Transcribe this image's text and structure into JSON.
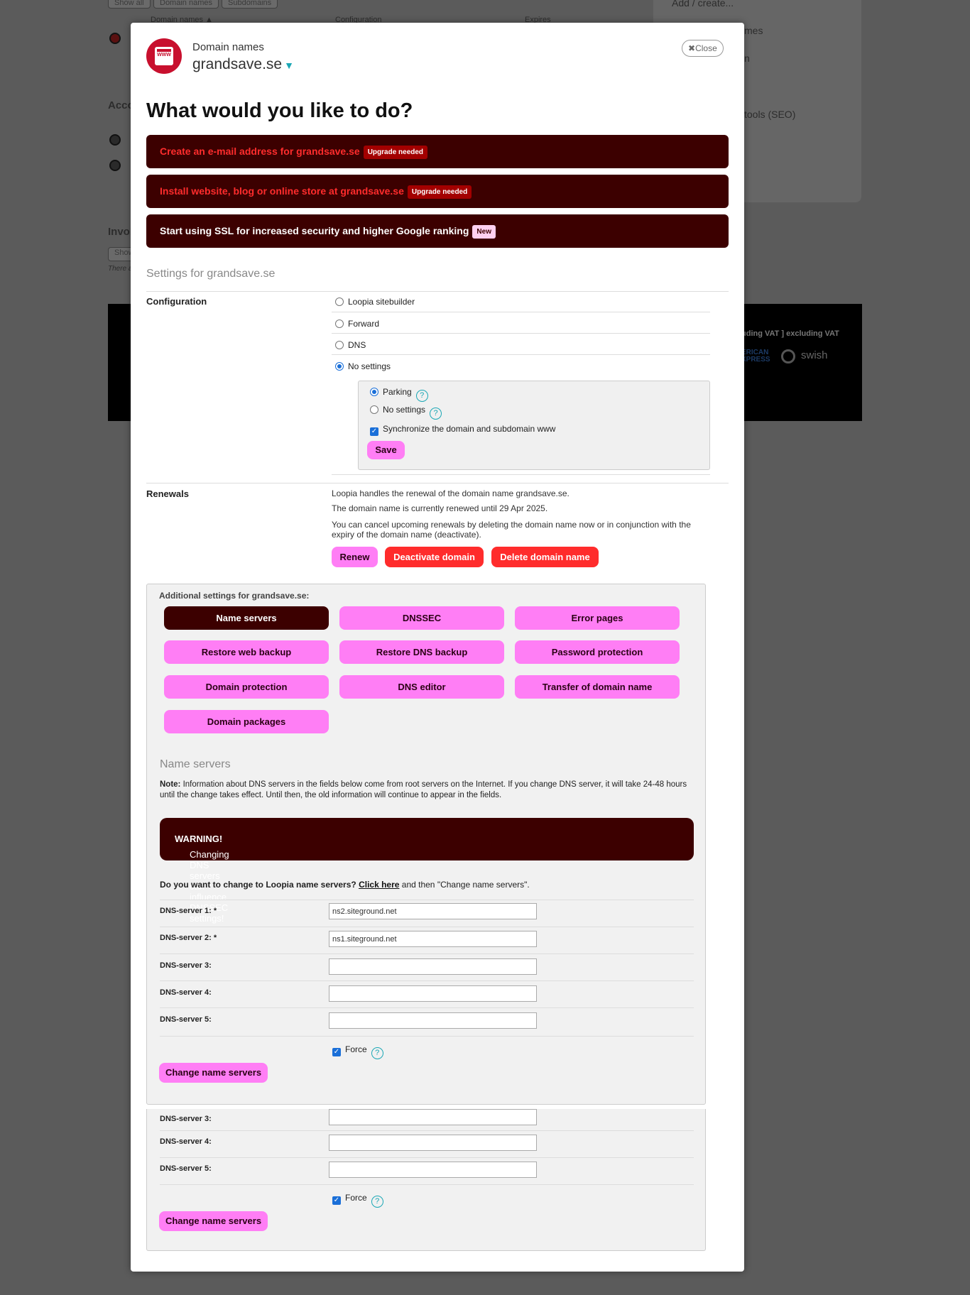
{
  "background": {
    "buttons": [
      "Show all",
      "Domain names",
      "Subdomains"
    ],
    "table_headers": [
      "Domain names ▲",
      "Configuration",
      "Expires"
    ],
    "section_acco": "Acco",
    "section_invo": "Invol",
    "show_btn": "Show",
    "there_text": "There a",
    "right_items": [
      "Add / create...",
      "mes",
      "n",
      "tools (SEO)"
    ],
    "vat_text": "uding VAT ] excluding VAT",
    "payment_text": "ERICAN XPRESS",
    "swish": "swish"
  },
  "modal": {
    "subtitle": "Domain names",
    "domain": "grandsave.se",
    "close_label": "Close",
    "title": "What would you like to do?",
    "actions": [
      {
        "label": "Create an e-mail address for grandsave.se",
        "badge": "Upgrade needed"
      },
      {
        "label": "Install website, blog or online store at grandsave.se",
        "badge": "Upgrade needed"
      },
      {
        "label": "Start using SSL for increased security and higher Google ranking",
        "badge": "New"
      }
    ],
    "settings_title": "Settings for grandsave.se",
    "configuration": {
      "label": "Configuration",
      "options": [
        "Loopia sitebuilder",
        "Forward",
        "DNS",
        "No settings"
      ],
      "selected": "No settings",
      "sub_options": [
        "Parking",
        "No settings"
      ],
      "sub_selected": "Parking",
      "sync_label": "Synchronize the domain and subdomain www",
      "sync_checked": true,
      "save_label": "Save"
    },
    "renewals": {
      "label": "Renewals",
      "line1": "Loopia handles the renewal of the domain name grandsave.se.",
      "line2": "The domain name is currently renewed until 29 Apr 2025.",
      "line3": "You can cancel upcoming renewals by deleting the domain name now or in conjunction with the",
      "line4": "expiry of the domain name (deactivate).",
      "renew": "Renew",
      "deactivate": "Deactivate domain",
      "delete": "Delete domain name"
    },
    "additional": {
      "title": "Additional settings for grandsave.se:",
      "buttons": [
        "Name servers",
        "DNSSEC",
        "Error pages",
        "Restore web backup",
        "Restore DNS backup",
        "Password protection",
        "Domain protection",
        "DNS editor",
        "Transfer of domain name",
        "Domain packages"
      ],
      "active": "Name servers"
    },
    "name_servers": {
      "title": "Name servers",
      "note_bold": "Note:",
      "note": " Information about DNS servers in the fields below come from root servers on the Internet. If you change DNS server, it will take 24-48 hours until the change takes effect. Until then, the old information will continue to appear in the fields.",
      "warning_bold": "WARNING!",
      "warning": " Changing DNS servers can influence DNSSEC settings!",
      "question": "Do you want to change to Loopia name servers?",
      "click_here": "Click here",
      "question_tail": " and then \"Change name servers\".",
      "fields": [
        {
          "label": "DNS-server 1: *",
          "value": "ns2.siteground.net"
        },
        {
          "label": "DNS-server 2: *",
          "value": "ns1.siteground.net"
        },
        {
          "label": "DNS-server 3:",
          "value": ""
        },
        {
          "label": "DNS-server 4:",
          "value": ""
        },
        {
          "label": "DNS-server 5:",
          "value": ""
        }
      ],
      "force_label": "Force",
      "force_checked": true,
      "change_label": "Change name servers"
    }
  }
}
